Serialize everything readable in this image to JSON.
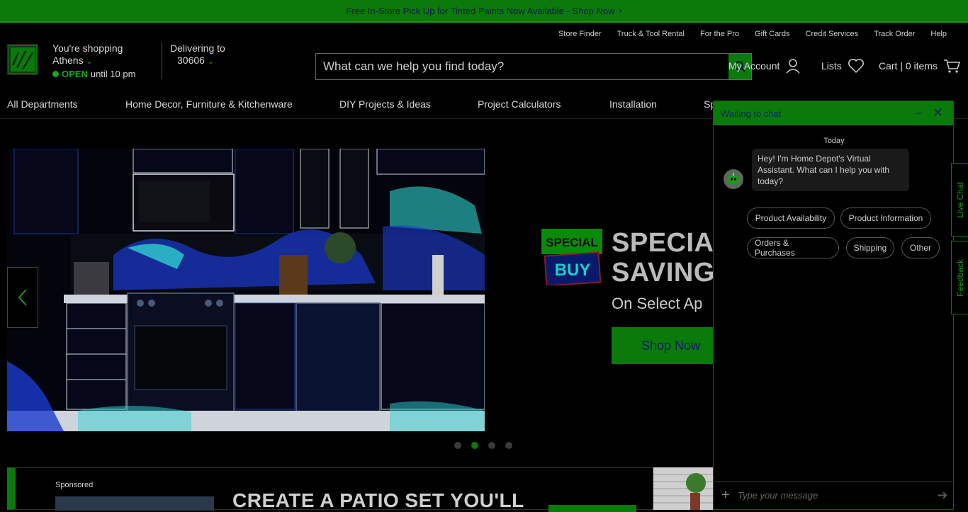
{
  "promo": {
    "text": "Free In-Store Pick Up for Tinted Paints Now Available - Shop Now"
  },
  "util_links": [
    "Store Finder",
    "Truck & Tool Rental",
    "For the Pro",
    "Gift Cards",
    "Credit Services",
    "Track Order",
    "Help"
  ],
  "store": {
    "line1": "You're shopping",
    "name": "Athens",
    "open_label": "OPEN",
    "hours": "until 10 pm"
  },
  "delivery": {
    "label": "Delivering to",
    "zip": "30606"
  },
  "search": {
    "placeholder": "What can we help you find today?"
  },
  "header_actions": {
    "account": "My Account",
    "lists": "Lists",
    "cart": "Cart | 0 items"
  },
  "nav": [
    "All Departments",
    "Home Decor, Furniture & Kitchenware",
    "DIY Projects & Ideas",
    "Project Calculators",
    "Installation",
    "Sp"
  ],
  "hero": {
    "badge_top": "SPECIAL",
    "badge_bottom": "BUY",
    "title_line1": "SPECIAL",
    "title_line2": "SAVINGS",
    "subtitle": "On Select Ap",
    "cta": "Shop Now",
    "slides": 4,
    "active_slide": 2
  },
  "sponsored": {
    "label": "Sponsored",
    "headline": "CREATE A PATIO SET YOU'LL"
  },
  "chat": {
    "title": "Waiting to chat",
    "date_label": "Today",
    "message": "Hey! I'm Home Depot's Virtual Assistant. What can I help you with today?",
    "options": [
      "Product Availability",
      "Product Information",
      "Orders & Purchases",
      "Shipping",
      "Other"
    ],
    "input_placeholder": "Type your message"
  },
  "side_tabs": {
    "live_chat": "Live Chat",
    "feedback": "Feedback"
  },
  "colors": {
    "brand_green": "#0a7a0a",
    "background": "#000000"
  }
}
